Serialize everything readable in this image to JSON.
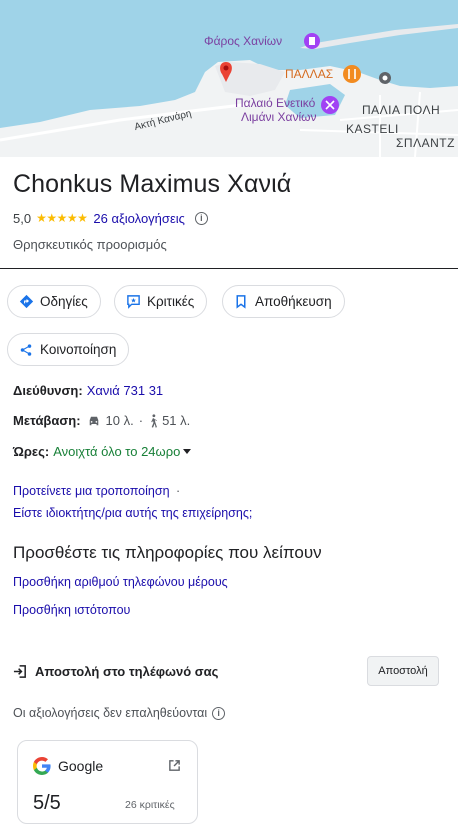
{
  "map": {
    "labels": {
      "lighthouse": "Φάρος Χανίων",
      "pallas": "ΠΑΛΛΑΣ",
      "old_harbour_1": "Παλαιό Ενετικό",
      "old_harbour_2": "Λιμάνι Χανίων",
      "old_town": "ΠΑΛΙΑ ΠΟΛΗ",
      "kasteli": "KASTELI",
      "splantzia": "ΣΠΛΑΝΤΖ",
      "road": "Ακτή Κανάρη"
    }
  },
  "place": {
    "name": "Chonkus Maximus Χανιά",
    "rating": "5,0",
    "stars": "★★★★★",
    "reviews_link": "26 αξιολογήσεις",
    "category": "Θρησκευτικός προορισμός"
  },
  "actions": {
    "directions": "Οδηγίες",
    "reviews": "Κριτικές",
    "save": "Αποθήκευση",
    "share": "Κοινοποίηση"
  },
  "details": {
    "address_label": "Διεύθυνση:",
    "address_value": "Χανιά 731 31",
    "transit_label": "Μετάβαση:",
    "drive_time": "10 λ.",
    "separator": "·",
    "walk_time": "51 λ.",
    "hours_label": "Ώρες:",
    "hours_value": "Ανοιχτά όλο το 24ωρο"
  },
  "suggest": {
    "edit": "Προτείνετε μια τροποποίηση",
    "edit_dot": "·",
    "owner": "Είστε ιδιοκτήτης/ρια αυτής της επιχείρησης;"
  },
  "missing_info": {
    "title": "Προσθέστε τις πληροφορίες που λείπουν",
    "add_phone": "Προσθήκη αριθμού τηλεφώνου μέρους",
    "add_website": "Προσθήκη ιστότοπου"
  },
  "send": {
    "label": "Αποστολή στο τηλέφωνό σας",
    "button": "Αποστολή"
  },
  "reviews_note": "Οι αξιολογήσεις δεν επαληθεύονται",
  "review_card": {
    "source": "Google",
    "score": "5/5",
    "count": "26 κριτικές"
  },
  "colors": {
    "link": "#1a0dab",
    "open_green": "#188038",
    "star": "#fbbc04",
    "map_water": "#9fd3e8",
    "pin_red": "#ea4335"
  }
}
